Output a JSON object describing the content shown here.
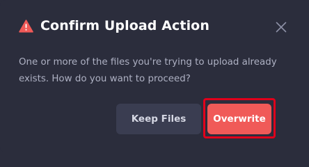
{
  "dialog": {
    "title": "Confirm Upload Action",
    "title_icon": "warning-triangle-icon",
    "close_icon": "close-icon",
    "message": "One or more of the files you're trying to upload already exists. How do you want to proceed?",
    "buttons": {
      "keep_label": "Keep Files",
      "overwrite_label": "Overwrite"
    }
  },
  "colors": {
    "background": "#2b2d3c",
    "warning_icon": "#f05a58",
    "primary_button": "#f05a58",
    "secondary_button": "#3a3d51",
    "highlight_frame": "#e0001b",
    "message_text": "#aeb1c3"
  }
}
